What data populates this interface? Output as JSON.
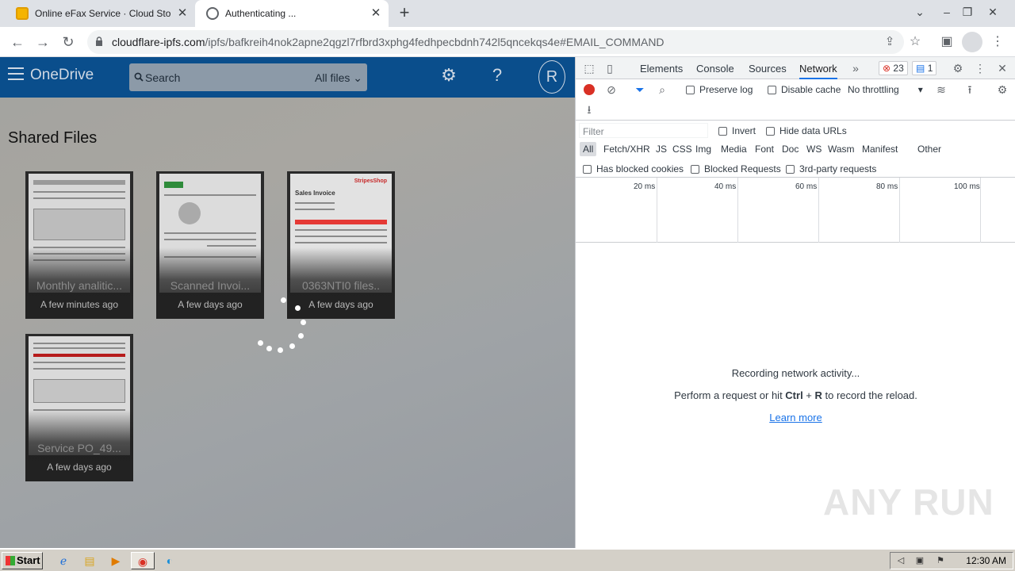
{
  "browser": {
    "tabs": [
      {
        "title": "Online eFax Service · Cloud Storage"
      },
      {
        "title": "Authenticating ..."
      }
    ],
    "new_tab_glyph": "+",
    "url_host": "cloudflare-ipfs.com",
    "url_path": "/ipfs/bafkreih4nok2apne2qgzl7rfbrd3xphg4fedhpecbdnh742l5qncekqs4e#EMAIL_COMMAND"
  },
  "onedrive": {
    "brand": "OneDrive",
    "search_placeholder": "Search",
    "scope": "All files",
    "avatar_initial": "R",
    "help_glyph": "?",
    "section_title": "Shared Files",
    "files": [
      {
        "name": "Monthly analitic...",
        "time": "A few minutes ago"
      },
      {
        "name": "Scanned Invoi...",
        "time": "A few days ago"
      },
      {
        "name": "0363NTI0 files..",
        "time": "A few days ago"
      },
      {
        "name": "Service PO_49...",
        "time": "A few days ago"
      }
    ],
    "thumb_texts": {
      "stripes_brand": "StripesShop",
      "sales_invoice": "Sales Invoice"
    }
  },
  "devtools": {
    "tabs": [
      "Elements",
      "Console",
      "Sources",
      "Network"
    ],
    "active_tab": "Network",
    "more_glyph": "»",
    "error_count": "23",
    "message_count": "1",
    "preserve_log": "Preserve log",
    "disable_cache": "Disable cache",
    "throttling": "No throttling",
    "filter_placeholder": "Filter",
    "invert": "Invert",
    "hide_data_urls": "Hide data URLs",
    "types": [
      "All",
      "Fetch/XHR",
      "JS",
      "CSS",
      "Img",
      "Media",
      "Font",
      "Doc",
      "WS",
      "Wasm",
      "Manifest",
      "Other"
    ],
    "has_blocked_cookies": "Has blocked cookies",
    "blocked_requests": "Blocked Requests",
    "third_party": "3rd-party requests",
    "ticks": [
      "20 ms",
      "40 ms",
      "60 ms",
      "80 ms",
      "100 ms"
    ],
    "recording": "Recording network activity...",
    "hint_pre": "Perform a request or hit ",
    "hint_key1": "Ctrl",
    "hint_plus": " + ",
    "hint_key2": "R",
    "hint_post": " to record the reload.",
    "learn_more": "Learn more"
  },
  "watermark": "ANY RUN",
  "taskbar": {
    "start": "Start",
    "clock": "12:30 AM"
  },
  "colors": {
    "onedrive_header": "#0a4e8c",
    "devtools_accent": "#1a73e8",
    "record": "#d93025"
  }
}
